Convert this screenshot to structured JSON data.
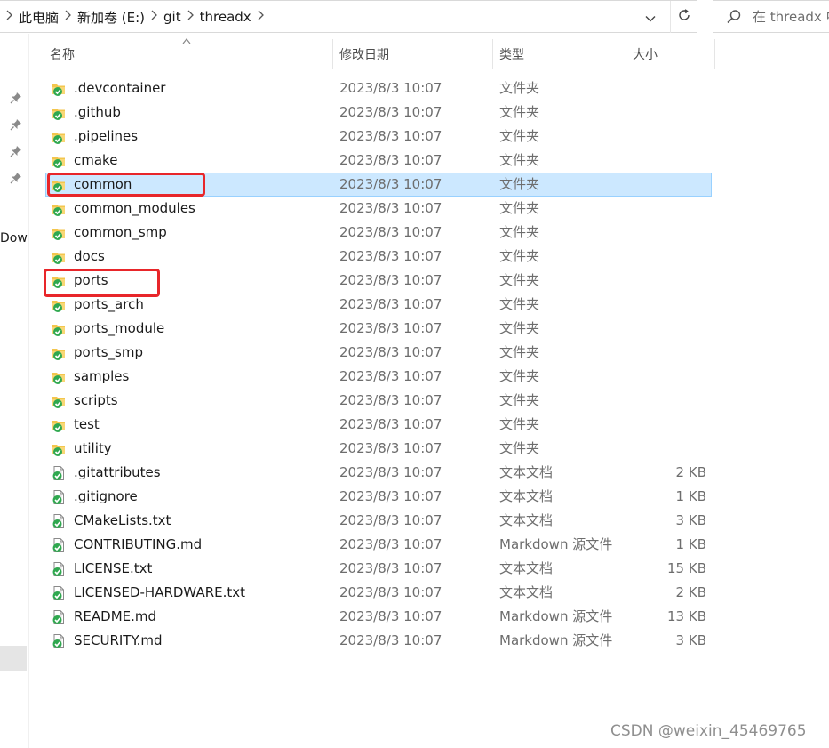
{
  "address": {
    "crumbs": [
      "此电脑",
      "新加卷 (E:)",
      "git",
      "threadx"
    ],
    "dropdown_icon": "chevron-down-icon",
    "refresh_icon": "refresh-icon"
  },
  "search": {
    "placeholder": "在 threadx 中搜索",
    "icon": "search-icon"
  },
  "navpane": {
    "partial_label": "Dow"
  },
  "columns": {
    "name": "名称",
    "date": "修改日期",
    "type": "类型",
    "size": "大小"
  },
  "rows": [
    {
      "name": ".devcontainer",
      "date": "2023/8/3 10:07",
      "type": "文件夹",
      "size": "",
      "kind": "folder"
    },
    {
      "name": ".github",
      "date": "2023/8/3 10:07",
      "type": "文件夹",
      "size": "",
      "kind": "folder"
    },
    {
      "name": ".pipelines",
      "date": "2023/8/3 10:07",
      "type": "文件夹",
      "size": "",
      "kind": "folder"
    },
    {
      "name": "cmake",
      "date": "2023/8/3 10:07",
      "type": "文件夹",
      "size": "",
      "kind": "folder"
    },
    {
      "name": "common",
      "date": "2023/8/3 10:07",
      "type": "文件夹",
      "size": "",
      "kind": "folder",
      "selected": true
    },
    {
      "name": "common_modules",
      "date": "2023/8/3 10:07",
      "type": "文件夹",
      "size": "",
      "kind": "folder"
    },
    {
      "name": "common_smp",
      "date": "2023/8/3 10:07",
      "type": "文件夹",
      "size": "",
      "kind": "folder"
    },
    {
      "name": "docs",
      "date": "2023/8/3 10:07",
      "type": "文件夹",
      "size": "",
      "kind": "folder"
    },
    {
      "name": "ports",
      "date": "2023/8/3 10:07",
      "type": "文件夹",
      "size": "",
      "kind": "folder"
    },
    {
      "name": "ports_arch",
      "date": "2023/8/3 10:07",
      "type": "文件夹",
      "size": "",
      "kind": "folder"
    },
    {
      "name": "ports_module",
      "date": "2023/8/3 10:07",
      "type": "文件夹",
      "size": "",
      "kind": "folder"
    },
    {
      "name": "ports_smp",
      "date": "2023/8/3 10:07",
      "type": "文件夹",
      "size": "",
      "kind": "folder"
    },
    {
      "name": "samples",
      "date": "2023/8/3 10:07",
      "type": "文件夹",
      "size": "",
      "kind": "folder"
    },
    {
      "name": "scripts",
      "date": "2023/8/3 10:07",
      "type": "文件夹",
      "size": "",
      "kind": "folder"
    },
    {
      "name": "test",
      "date": "2023/8/3 10:07",
      "type": "文件夹",
      "size": "",
      "kind": "folder"
    },
    {
      "name": "utility",
      "date": "2023/8/3 10:07",
      "type": "文件夹",
      "size": "",
      "kind": "folder"
    },
    {
      "name": ".gitattributes",
      "date": "2023/8/3 10:07",
      "type": "文本文档",
      "size": "2 KB",
      "kind": "file"
    },
    {
      "name": ".gitignore",
      "date": "2023/8/3 10:07",
      "type": "文本文档",
      "size": "1 KB",
      "kind": "file"
    },
    {
      "name": "CMakeLists.txt",
      "date": "2023/8/3 10:07",
      "type": "文本文档",
      "size": "3 KB",
      "kind": "file"
    },
    {
      "name": "CONTRIBUTING.md",
      "date": "2023/8/3 10:07",
      "type": "Markdown 源文件",
      "size": "1 KB",
      "kind": "file"
    },
    {
      "name": "LICENSE.txt",
      "date": "2023/8/3 10:07",
      "type": "文本文档",
      "size": "15 KB",
      "kind": "file"
    },
    {
      "name": "LICENSED-HARDWARE.txt",
      "date": "2023/8/3 10:07",
      "type": "文本文档",
      "size": "2 KB",
      "kind": "file"
    },
    {
      "name": "README.md",
      "date": "2023/8/3 10:07",
      "type": "Markdown 源文件",
      "size": "13 KB",
      "kind": "file"
    },
    {
      "name": "SECURITY.md",
      "date": "2023/8/3 10:07",
      "type": "Markdown 源文件",
      "size": "3 KB",
      "kind": "file"
    }
  ],
  "highlights": [
    "common",
    "ports"
  ],
  "colors": {
    "selection_bg": "#cce8ff",
    "selection_border": "#99d1ff",
    "highlight_box": "#e8262a",
    "folder": "#f3c64d",
    "git_overlay": "#2fa84f"
  },
  "watermark": "CSDN @weixin_45469765"
}
